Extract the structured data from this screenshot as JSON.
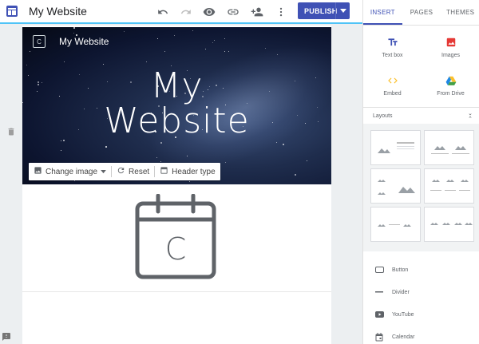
{
  "topbar": {
    "title": "My Website",
    "icons": [
      "undo-icon",
      "redo-icon",
      "preview-icon",
      "link-icon",
      "share-icon",
      "more-icon"
    ],
    "publish_label": "PUBLISH"
  },
  "header": {
    "site_name": "My Website",
    "logo_letter": "C",
    "hero_line1": "My",
    "hero_line2": "Website",
    "toolbar": {
      "change_image": "Change image",
      "reset": "Reset",
      "header_type": "Header type"
    }
  },
  "content": {
    "calendar_letter": "C"
  },
  "panel": {
    "tabs": [
      {
        "label": "INSERT",
        "active": true
      },
      {
        "label": "PAGES",
        "active": false
      },
      {
        "label": "THEMES",
        "active": false
      }
    ],
    "insert_items": [
      {
        "label": "Text box",
        "icon": "text-box-icon"
      },
      {
        "label": "Images",
        "icon": "images-icon"
      },
      {
        "label": "Embed",
        "icon": "embed-icon"
      },
      {
        "label": "From Drive",
        "icon": "drive-icon"
      }
    ],
    "layouts_label": "Layouts",
    "components": [
      {
        "label": "Button",
        "icon": "button-icon"
      },
      {
        "label": "Divider",
        "icon": "divider-icon"
      },
      {
        "label": "YouTube",
        "icon": "youtube-icon"
      },
      {
        "label": "Calendar",
        "icon": "calendar-icon"
      }
    ]
  },
  "colors": {
    "accent": "#3f51b5",
    "topbar_underline": "#4fc3f7",
    "panel_bg": "#ffffff",
    "gutter_bg": "#eceff1"
  }
}
